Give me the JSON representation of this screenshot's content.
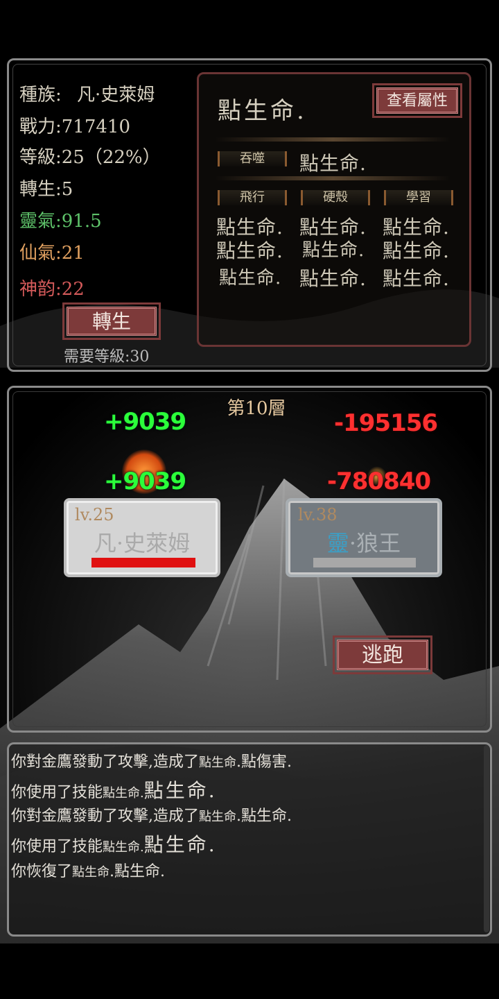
{
  "player_panel": {
    "race_label": "種族:",
    "race_value": "凡·史萊姆",
    "power": "戰力:717410",
    "level": "等級:25（22%）",
    "rebirth": "轉生:5",
    "spirit": "靈氣:91.5",
    "immortal": "仙氣:21",
    "charm": "神韵:22",
    "rebirth_button": "轉生",
    "rebirth_requirement": "需要等級:30"
  },
  "skill_panel": {
    "title": "點生命.",
    "view_attr_button": "查看屬性",
    "devour_label": "吞噬",
    "devour_value": "點生命.",
    "col_labels": [
      "飛行",
      "硬殼",
      "學習"
    ],
    "grid": [
      [
        "點生命.",
        "點生命.",
        "點生命."
      ],
      [
        "點生命.",
        "點生命.",
        "點生命."
      ],
      [
        "點生命.",
        "點生命.",
        "點生命."
      ]
    ]
  },
  "battle": {
    "floor": "第10層",
    "damage_texts": {
      "left_top": "+9039",
      "left_bottom": "+9039",
      "right_top": "-195156",
      "right_bottom": "-780840"
    },
    "player_unit": {
      "level": "lv.25",
      "name": "凡·史萊姆",
      "hp_fraction": 1.0,
      "hp_color": "#e01010"
    },
    "enemy_unit": {
      "level": "lv.38",
      "name_prefix": "靈",
      "name_rest": "·狼王",
      "hp_fraction": 0.0,
      "prefix_color": "#3aa0c8"
    },
    "flee_button": "逃跑"
  },
  "log": {
    "lines": [
      {
        "a": "你對金鷹發動了攻擊,造成了",
        "b": "點生命",
        "c": ".點傷害."
      },
      {
        "a": "你使用了技能",
        "b": "點生命.",
        "c": "點生命."
      },
      {
        "a": "你對金鷹發動了攻擊,造成了",
        "b": "點生命",
        "c": ".點生命."
      },
      {
        "a": "你使用了技能",
        "b": "點生命.",
        "c": "點生命."
      },
      {
        "a": "你恢復了",
        "b": "點生命",
        "c": ".點生命."
      }
    ]
  },
  "colors": {
    "spirit": "#5ec36a",
    "immortal": "#e0a060",
    "charm": "#d45a5a",
    "button_red": "#7d3a3a"
  }
}
